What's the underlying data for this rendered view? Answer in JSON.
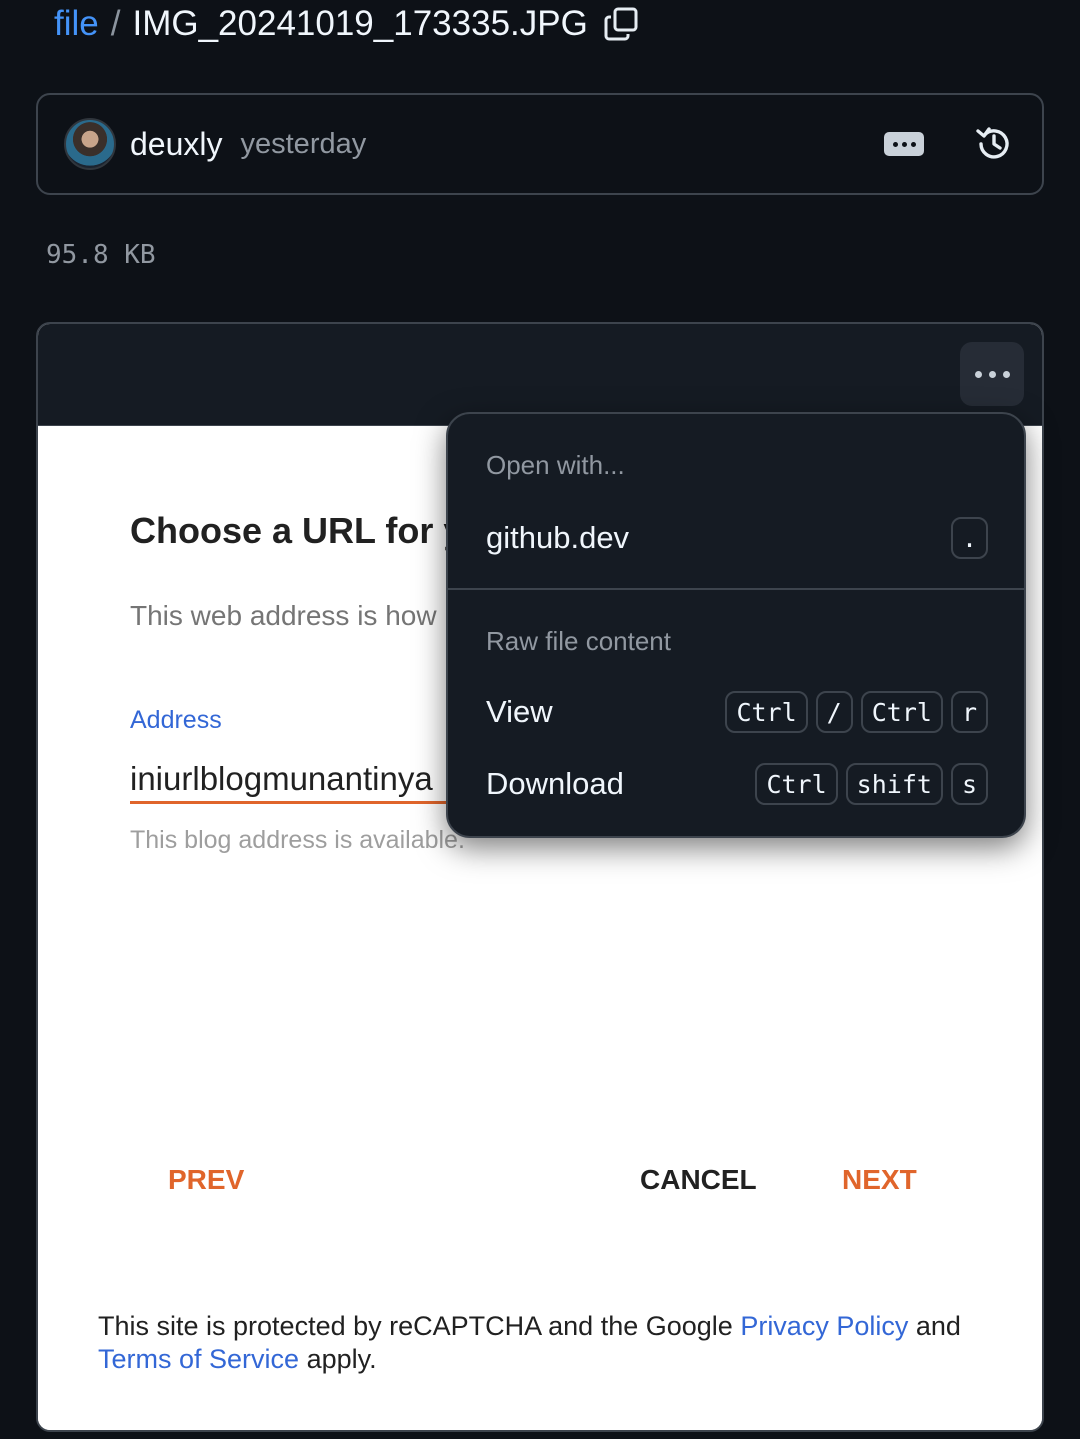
{
  "breadcrumb": {
    "folder": "file",
    "separator": "/",
    "filename": "IMG_20241019_173335.JPG",
    "copy_icon": "copy-icon"
  },
  "commit": {
    "author": "deuxly",
    "time": "yesterday",
    "message_icon": "ellipsis-icon",
    "history_icon": "history-icon"
  },
  "file_size": "95.8 KB",
  "viewer": {
    "more_icon": "kebab-horizontal-icon"
  },
  "image_content": {
    "title": "Choose a URL for y",
    "subtitle": "This web address is how",
    "address_label": "Address",
    "address_value": "iniurlblogmunantinya",
    "hint": "This blog address is available.",
    "prev": "PREV",
    "cancel": "CANCEL",
    "next": "NEXT",
    "recaptcha_pre": "This site is protected by reCAPTCHA and the Google ",
    "privacy": "Privacy Policy",
    "and": " and",
    "terms": "Terms of Service",
    "apply": " apply."
  },
  "menu": {
    "group1_label": "Open with...",
    "item_githubdev": {
      "label": "github.dev",
      "keys": [
        "."
      ]
    },
    "group2_label": "Raw file content",
    "item_view": {
      "label": "View",
      "keys": [
        "Ctrl",
        "/",
        "Ctrl",
        "r"
      ]
    },
    "item_download": {
      "label": "Download",
      "keys": [
        "Ctrl",
        "shift",
        "s"
      ]
    }
  },
  "colors": {
    "link": "#4493f8",
    "accent_orange": "#e0652b",
    "bg": "#0d1117"
  }
}
